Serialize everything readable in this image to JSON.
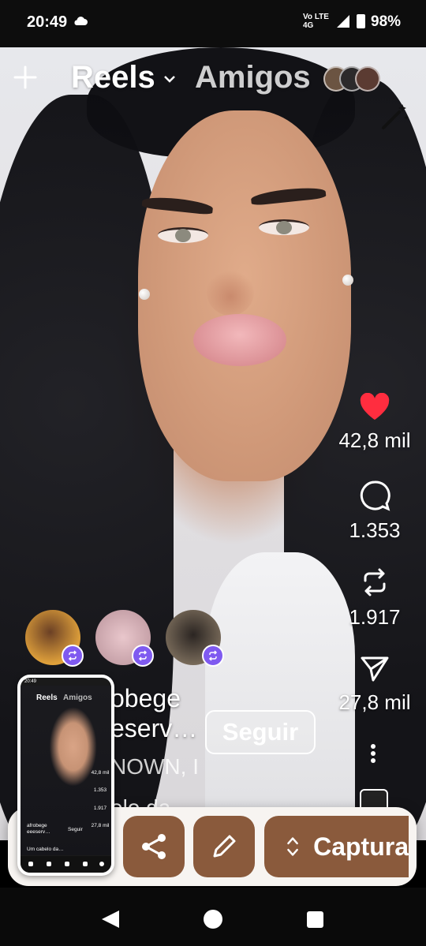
{
  "status_bar": {
    "time": "20:49",
    "network": "Vo LTE 4G",
    "battery": "98%"
  },
  "header": {
    "create_icon": "plus-icon",
    "tab_reels": "Reels",
    "tab_amigos": "Amigos",
    "effects_icon": "magic-wand-icon"
  },
  "actions": {
    "likes": "42,8 mil",
    "comments": "1.353",
    "reposts": "1.917",
    "shares": "27,8 mil",
    "like_color": "#ff2d3f"
  },
  "post": {
    "author_partial": "obege",
    "author_partial2": "eserv…",
    "follow_label": "Seguir",
    "audio_partial": "NOWN, I",
    "caption_partial": "elo da"
  },
  "screenshot_tray": {
    "share_icon": "share-icon",
    "edit_icon": "pencil-icon",
    "capture_label": "Captura",
    "accent": "#8a5a3c"
  },
  "thumbnail": {
    "time": "20:49",
    "tab_reels": "Reels",
    "tab_amigos": "Amigos",
    "likes": "42,8 mil",
    "comments": "1.353",
    "reposts": "1.917",
    "shares": "27,8 mil",
    "author_line1": "afrobege",
    "author_line2": "eeeserv…",
    "follow": "Seguir",
    "caption": "Um cabelo da…"
  }
}
